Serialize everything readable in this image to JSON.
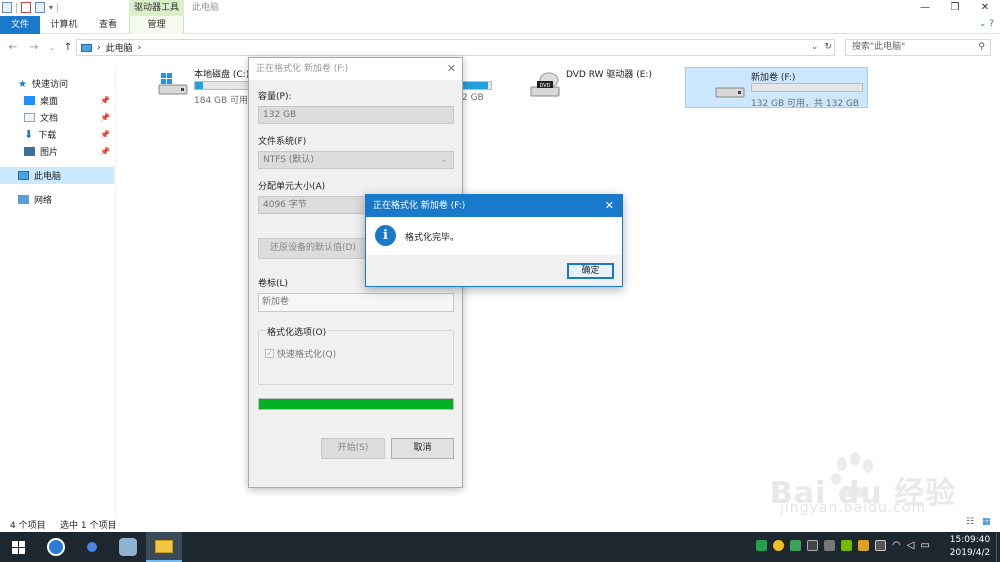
{
  "window": {
    "title": "此电脑",
    "controls": [
      "—",
      "❐",
      "✕"
    ]
  },
  "ribbon": {
    "tool_tab_title": "驱动器工具",
    "tabs": [
      "文件",
      "计算机",
      "查看",
      "管理"
    ]
  },
  "address": {
    "path": "此电脑",
    "separator": "›",
    "search_placeholder": "搜索\"此电脑\""
  },
  "sidebar": {
    "items": [
      {
        "label": "快速访问",
        "icon": "star-icon"
      },
      {
        "label": "桌面",
        "icon": "desktop-icon",
        "pinned": true
      },
      {
        "label": "文档",
        "icon": "documents-icon",
        "pinned": true
      },
      {
        "label": "下载",
        "icon": "download-icon",
        "pinned": true
      },
      {
        "label": "图片",
        "icon": "pictures-icon",
        "pinned": true
      },
      {
        "label": "此电脑",
        "icon": "computer-icon",
        "selected": true
      },
      {
        "label": "网络",
        "icon": "network-icon"
      }
    ]
  },
  "drives": [
    {
      "name": "本地磁盘 (C:)",
      "free": "184 GB 可用,",
      "used_fraction": 0.07,
      "icon": "windows-drive-icon"
    },
    {
      "name": "",
      "free": "2 GB",
      "used_fraction": 0.9,
      "icon": "drive-icon"
    },
    {
      "name": "DVD RW 驱动器 (E:)",
      "free": "",
      "icon": "dvd-drive-icon"
    },
    {
      "name": "新加卷 (F:)",
      "free": "132 GB 可用，共 132 GB",
      "used_fraction": 0.0,
      "icon": "drive-icon",
      "selected": true
    }
  ],
  "status": {
    "items_count": "4 个项目",
    "selected_count": "选中 1 个项目"
  },
  "format_dialog": {
    "title": "正在格式化 新加卷 (F:)",
    "capacity_label": "容量(P):",
    "capacity_value": "132 GB",
    "fs_label": "文件系统(F)",
    "fs_value": "NTFS (默认)",
    "alloc_label": "分配单元大小(A)",
    "alloc_value": "4096 字节",
    "restore_button": "还原设备的默认值(D)",
    "volume_label": "卷标(L)",
    "volume_value": "新加卷",
    "options_title": "格式化选项(O)",
    "quick_format": "快速格式化(Q)",
    "quick_format_checked": true,
    "progress_fraction": 1.0,
    "start_button": "开始(S)",
    "cancel_button": "取消"
  },
  "message_box": {
    "title": "正在格式化 新加卷 (F:)",
    "text": "格式化完毕。",
    "ok_button": "确定",
    "icon_glyph": "i"
  },
  "taskbar": {
    "time": "15:09:40",
    "date": "2019/4/2"
  },
  "watermark": {
    "brand": "Bai  du 经验",
    "url": "jingyan.baidu.com"
  },
  "colors": {
    "accent": "#1979ca",
    "progress_green": "#06b025",
    "drive_bar_blue": "#26a0da",
    "selection": "#cce8ff"
  }
}
